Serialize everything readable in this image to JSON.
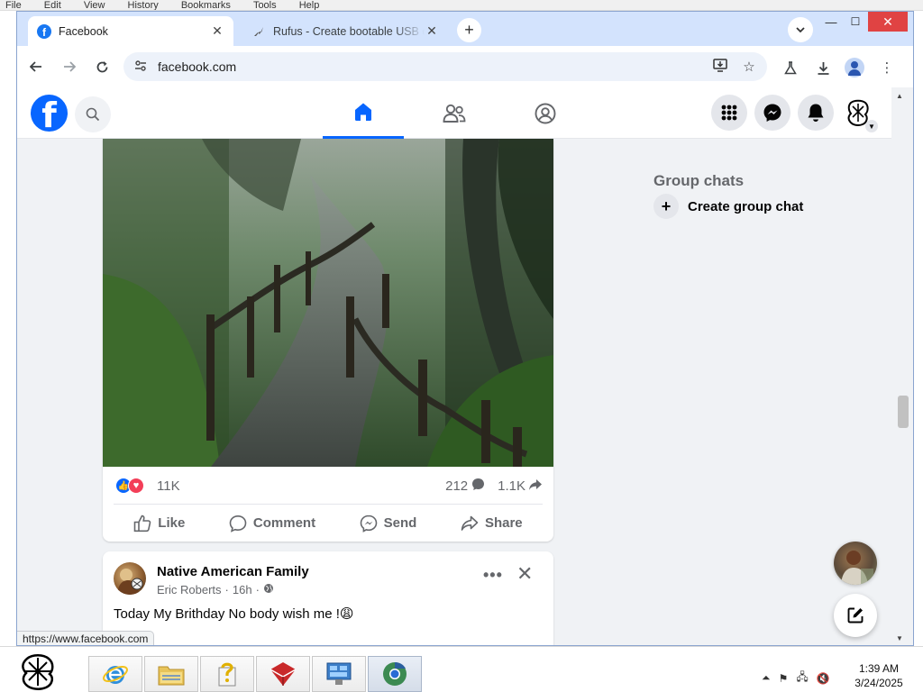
{
  "background_menu": [
    "File",
    "Edit",
    "View",
    "History",
    "Bookmarks",
    "Tools",
    "Help"
  ],
  "browser": {
    "tabs": [
      {
        "title": "Facebook",
        "active": true
      },
      {
        "title": "Rufus - Create bootable USB drives",
        "active": false
      }
    ],
    "new_tab_label": "+",
    "url": "facebook.com",
    "status_url": "https://www.facebook.com"
  },
  "facebook": {
    "logo_letter": "f",
    "post": {
      "reaction_count": "11K",
      "comment_count": "212",
      "share_count": "1.1K",
      "actions": {
        "like": "Like",
        "comment": "Comment",
        "send": "Send",
        "share": "Share"
      }
    },
    "post2": {
      "page_name": "Native American Family",
      "author": "Eric Roberts",
      "time": "16h",
      "separator": "·",
      "text": "Today My Brithday No body wish me !😩",
      "more": "•••",
      "close": "✕"
    },
    "right_rail": {
      "group_chats_title": "Group chats",
      "create_group_chat": "Create group chat"
    }
  },
  "taskbar": {
    "time": "1:39 AM",
    "date": "3/24/2025"
  },
  "colors": {
    "fb_blue": "#0866ff",
    "love_red": "#f33e58",
    "tab_strip": "#d3e3fd",
    "close_red": "#e04343"
  }
}
